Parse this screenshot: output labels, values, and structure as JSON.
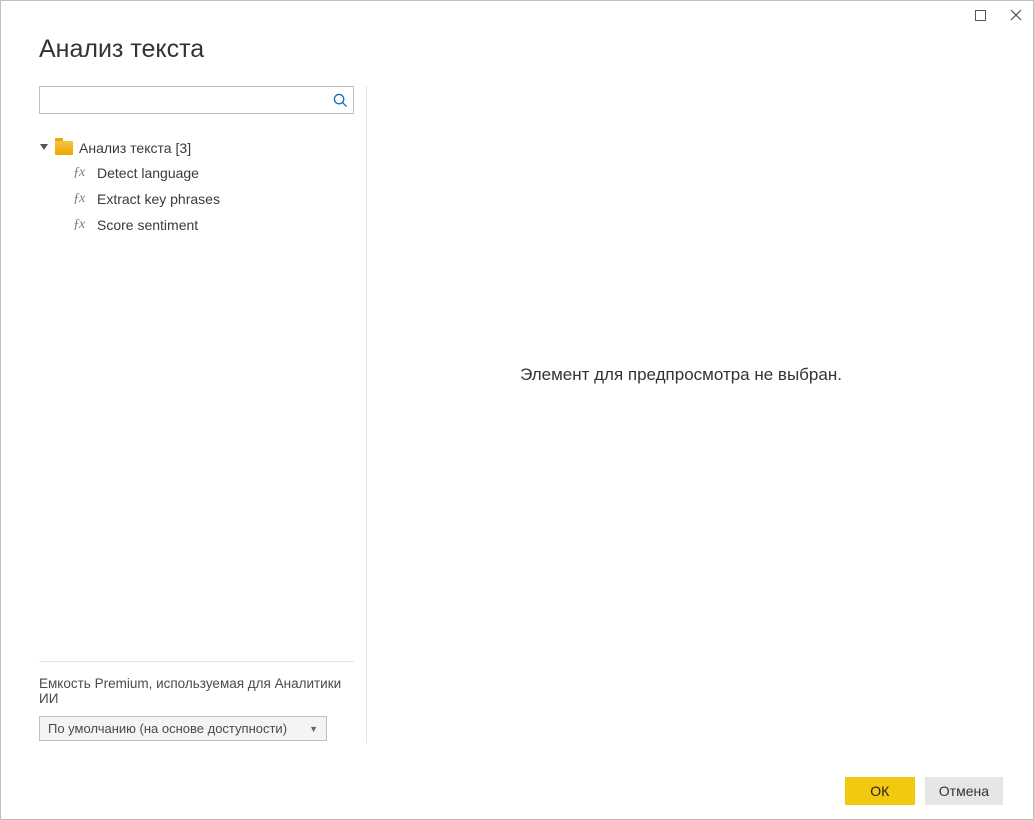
{
  "titlebar": {
    "maximize_icon": "maximize-icon",
    "close_icon": "close-icon"
  },
  "dialog": {
    "title": "Анализ текста"
  },
  "search": {
    "placeholder": ""
  },
  "tree": {
    "folder": {
      "label": "Анализ текста",
      "count": "[3]"
    },
    "items": [
      {
        "label": "Detect language"
      },
      {
        "label": "Extract key phrases"
      },
      {
        "label": "Score sentiment"
      }
    ]
  },
  "capacity": {
    "label": "Емкость Premium, используемая для Аналитики ИИ",
    "selected": "По умолчанию (на основе доступности)"
  },
  "preview": {
    "empty_message": "Элемент для предпросмотра не выбран."
  },
  "footer": {
    "ok_label": "ОК",
    "cancel_label": "Отмена"
  }
}
